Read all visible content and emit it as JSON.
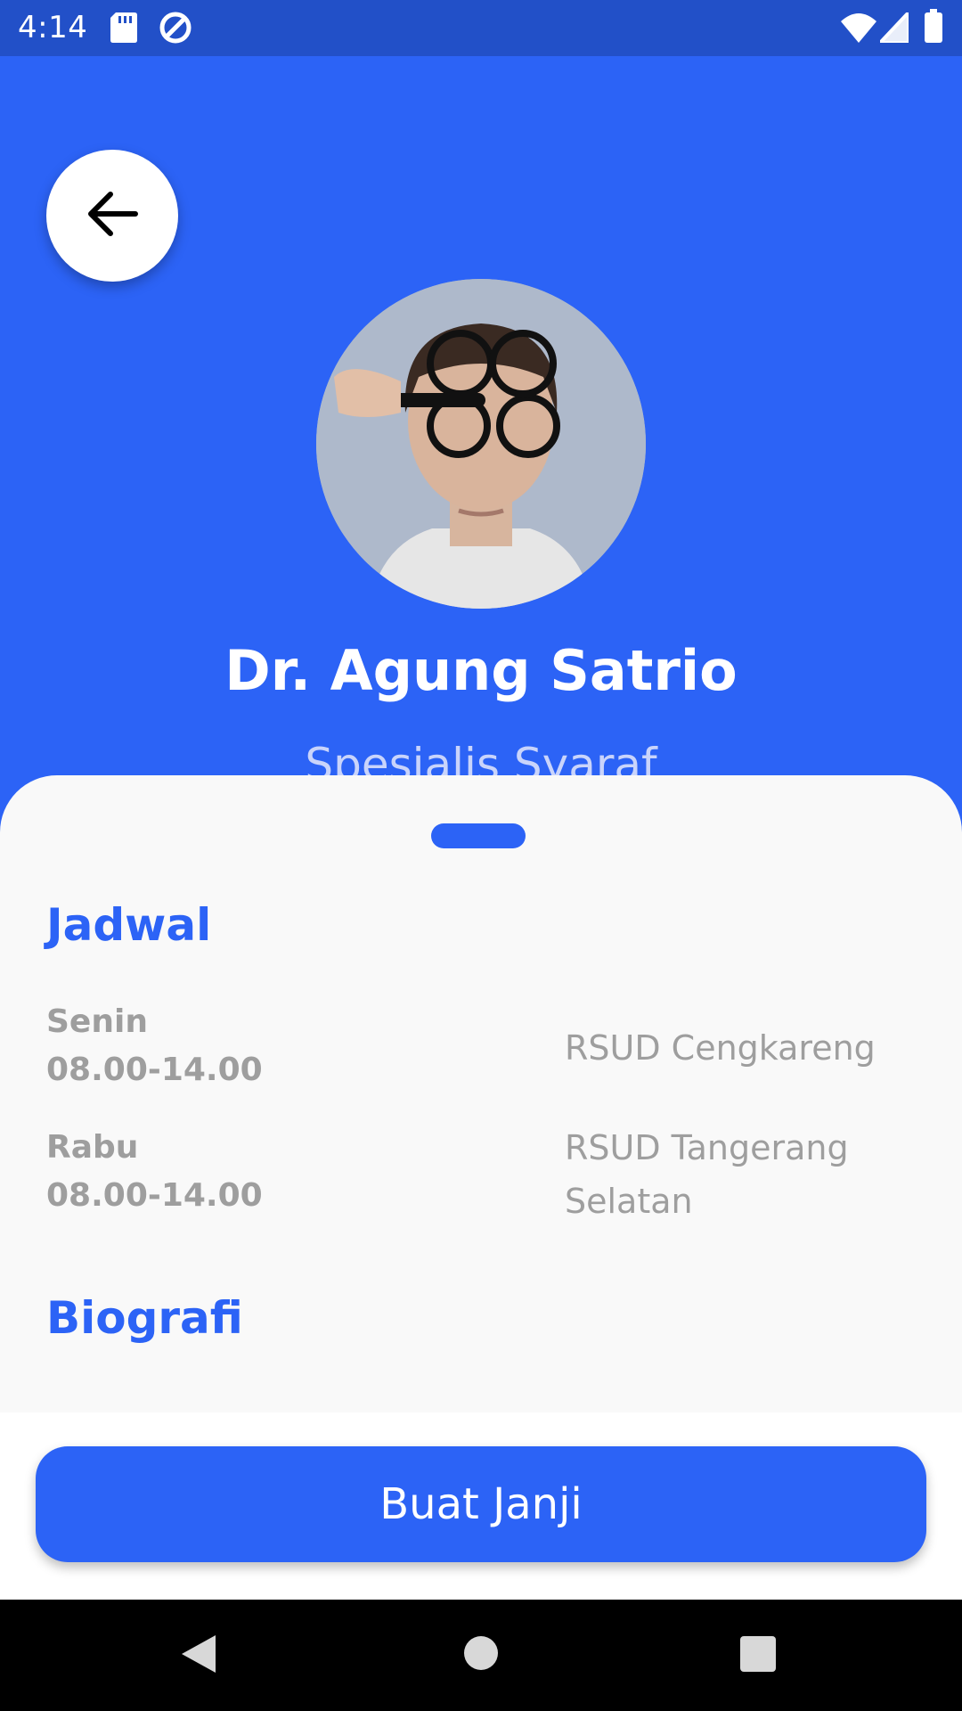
{
  "status_bar": {
    "time": "4:14",
    "icons": [
      "sd-card-icon",
      "data-saver-icon",
      "wifi-icon",
      "signal-icon",
      "battery-icon"
    ]
  },
  "header": {
    "back_icon": "arrow-left-icon",
    "doctor_name": "Dr. Agung Satrio",
    "specialty": "Spesialis Syaraf",
    "background_color": "#2c63f6"
  },
  "schedule": {
    "title": "Jadwal",
    "items": [
      {
        "day": "Senin",
        "time": "08.00-14.00",
        "place": "RSUD Cengkareng"
      },
      {
        "day": "Rabu",
        "time": "08.00-14.00",
        "place": "RSUD Tangerang Selatan"
      }
    ]
  },
  "biography": {
    "title": "Biografi"
  },
  "footer": {
    "button_label": "Buat Janji"
  },
  "nav_bar": {
    "icons": [
      "back-triangle-icon",
      "home-circle-icon",
      "recents-square-icon"
    ]
  }
}
